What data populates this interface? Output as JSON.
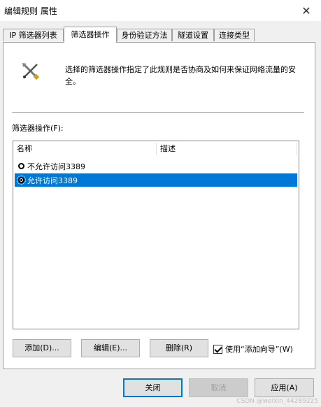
{
  "window": {
    "title": "编辑规则 属性"
  },
  "tabs": [
    {
      "label": "IP 筛选器列表"
    },
    {
      "label": "筛选器操作"
    },
    {
      "label": "身份验证方法"
    },
    {
      "label": "隧道设置"
    },
    {
      "label": "连接类型"
    }
  ],
  "active_tab": "筛选器操作",
  "header": {
    "icon": "tools-icon",
    "description": "选择的筛选器操作指定了此规则是否协商及如何来保证网络流量的安全。"
  },
  "list": {
    "label": "筛选器操作(F):",
    "columns": [
      "名称",
      "描述"
    ],
    "rows": [
      {
        "name": "不允许访问3389",
        "selected": false
      },
      {
        "name": "允许访问3389",
        "selected": true
      }
    ]
  },
  "actions": {
    "add": "添加(D)...",
    "edit": "编辑(E)...",
    "remove": "删除(R)",
    "use_wizard": "使用“添加向导”(W)",
    "use_wizard_checked": true
  },
  "footer": {
    "close": "关闭",
    "cancel": "取消",
    "apply": "应用(A)"
  },
  "watermark": "CSDN @weixin_44289225",
  "colors": {
    "selection": "#0078d7",
    "default_border": "#0078d7"
  }
}
